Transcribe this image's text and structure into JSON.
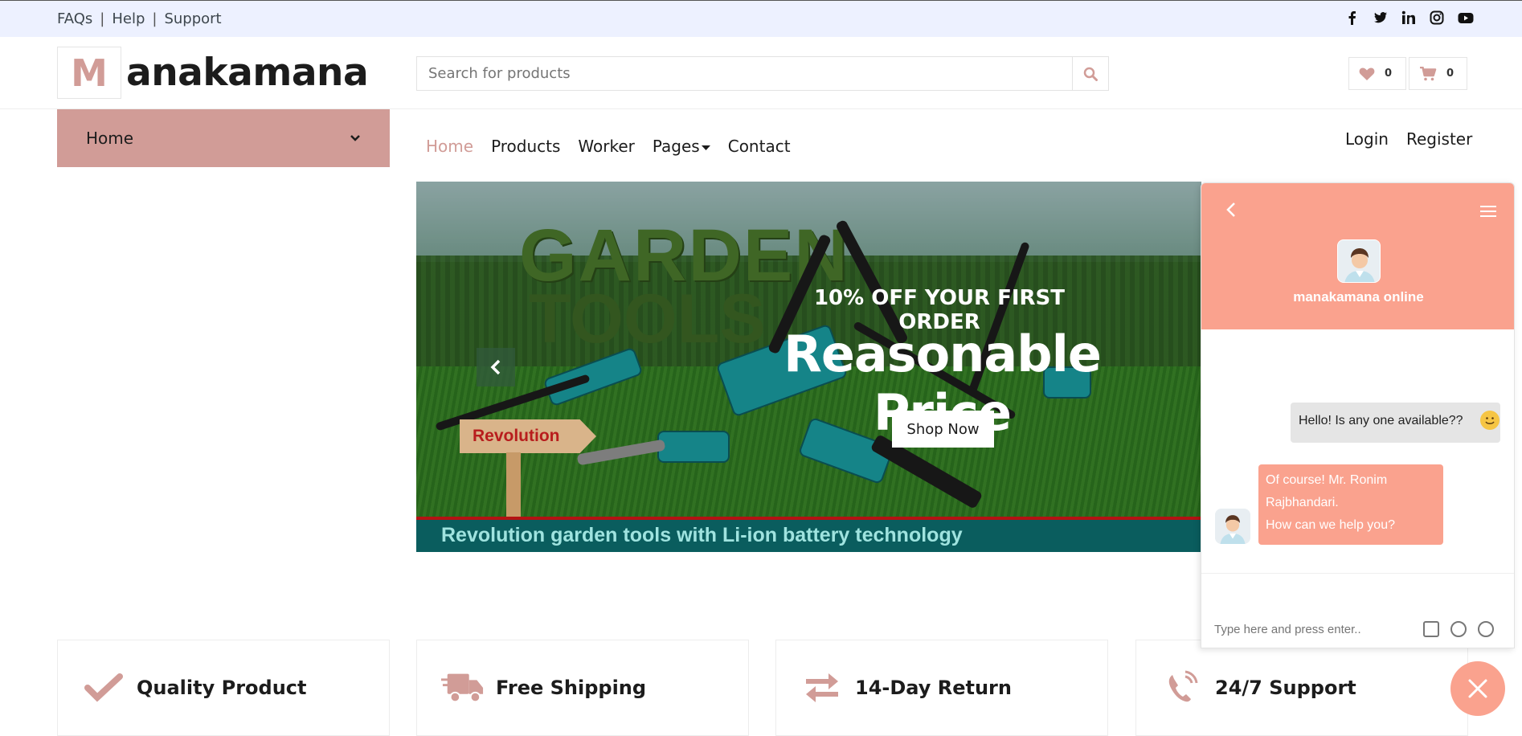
{
  "topbar": {
    "links": [
      "FAQs",
      "Help",
      "Support"
    ],
    "separator": "|",
    "social_icons": [
      "facebook-icon",
      "twitter-icon",
      "linkedin-icon",
      "instagram-icon",
      "youtube-icon"
    ]
  },
  "header": {
    "logo_letter": "M",
    "logo_text": "anakamana",
    "search_placeholder": "Search for products",
    "wishlist_count": "0",
    "cart_count": "0"
  },
  "category": {
    "label": "Home"
  },
  "nav": {
    "items": [
      "Home",
      "Products",
      "Worker",
      "Pages",
      "Contact"
    ],
    "active": "Home",
    "login": "Login",
    "register": "Register"
  },
  "hero": {
    "offer": "10% OFF YOUR FIRST ORDER",
    "title": "Reasonable Price",
    "button": "Shop Now",
    "image_texts": {
      "garden": "GARDEN",
      "tools": "TOOLS",
      "sign": "Revolution",
      "banner": "Revolution garden tools with Li-ion battery technology"
    }
  },
  "features": [
    {
      "label": "Quality Product",
      "icon": "check-icon"
    },
    {
      "label": "Free Shipping",
      "icon": "truck-icon"
    },
    {
      "label": "14-Day Return",
      "icon": "exchange-icon"
    },
    {
      "label": "24/7 Support",
      "icon": "phone-icon"
    }
  ],
  "chat": {
    "agent_name": "manakamana online",
    "outgoing_message": "Hello! Is any one available??",
    "incoming_message_lines": [
      "Of course! Mr. Ronim",
      "Rajbhandari.",
      "How can we help you?"
    ],
    "input_placeholder": "Type here and press enter.."
  },
  "colors": {
    "accent": "#d19c97",
    "topbar_bg": "#edf1ff",
    "chat_accent": "#faa28e"
  }
}
